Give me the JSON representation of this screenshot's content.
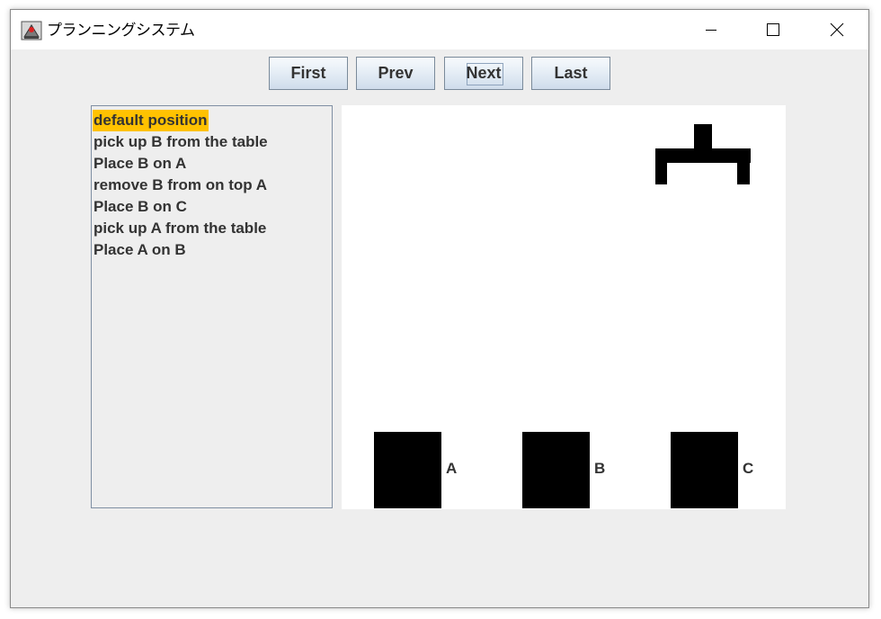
{
  "window": {
    "title": "プランニングシステム"
  },
  "nav": {
    "first_label": "First",
    "prev_label": "Prev",
    "next_label": "Next",
    "last_label": "Last"
  },
  "steps": [
    {
      "label": "default position",
      "selected": true
    },
    {
      "label": "pick up B from the table",
      "selected": false
    },
    {
      "label": "Place B on A",
      "selected": false
    },
    {
      "label": "remove B from on top A",
      "selected": false
    },
    {
      "label": "Place B on C",
      "selected": false
    },
    {
      "label": "pick up A from the table",
      "selected": false
    },
    {
      "label": "Place A on B",
      "selected": false
    }
  ],
  "canvas": {
    "blocks": [
      {
        "label": "A"
      },
      {
        "label": "B"
      },
      {
        "label": "C"
      }
    ]
  },
  "colors": {
    "selection": "#ffc200",
    "block": "#000000",
    "canvas_bg": "#ffffff",
    "window_bg": "#eeeeee"
  }
}
